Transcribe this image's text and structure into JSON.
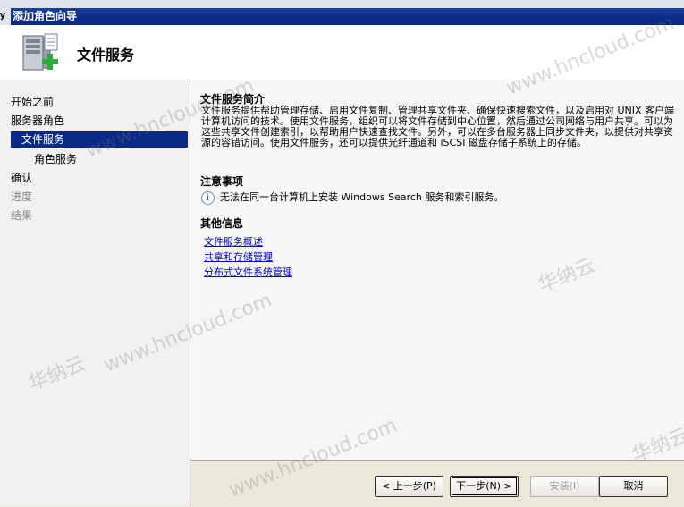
{
  "window": {
    "prefix": "y",
    "title": "添加角色向导",
    "header_title": "文件服务"
  },
  "nav": {
    "items": [
      {
        "label": "开始之前",
        "state": "done"
      },
      {
        "label": "服务器角色",
        "state": "done"
      },
      {
        "label": "文件服务",
        "state": "selected"
      },
      {
        "label": "角色服务",
        "state": "sub"
      },
      {
        "label": "确认",
        "state": "active"
      },
      {
        "label": "进度",
        "state": "dim"
      },
      {
        "label": "结果",
        "state": "dim"
      }
    ]
  },
  "content": {
    "intro_title": "文件服务简介",
    "intro_text": "文件服务提供帮助管理存储、启用文件复制、管理共享文件夹、确保快速搜索文件，以及启用对 UNIX 客户端计算机访问的技术。使用文件服务，组织可以将文件存储到中心位置，然后通过公司网络与用户共享。可以为这些共享文件创建索引，以帮助用户快速查找文件。另外，可以在多台服务器上同步文件夹，以提供对共享资源的容错访问。使用文件服务，还可以提供光纤通道和 iSCSI 磁盘存储子系统上的存储。",
    "notes_title": "注意事项",
    "note_text": "无法在同一台计算机上安装 Windows Search 服务和索引服务。",
    "more_title": "其他信息",
    "links": [
      "文件服务概述",
      "共享和存储管理",
      "分布式文件系统管理"
    ]
  },
  "buttons": {
    "prev": "< 上一步(P)",
    "next": "下一步(N) >",
    "install": "安装(I)",
    "cancel": "取消"
  },
  "watermark": {
    "site": "www.hncloud.com",
    "brand": "华纳云"
  }
}
